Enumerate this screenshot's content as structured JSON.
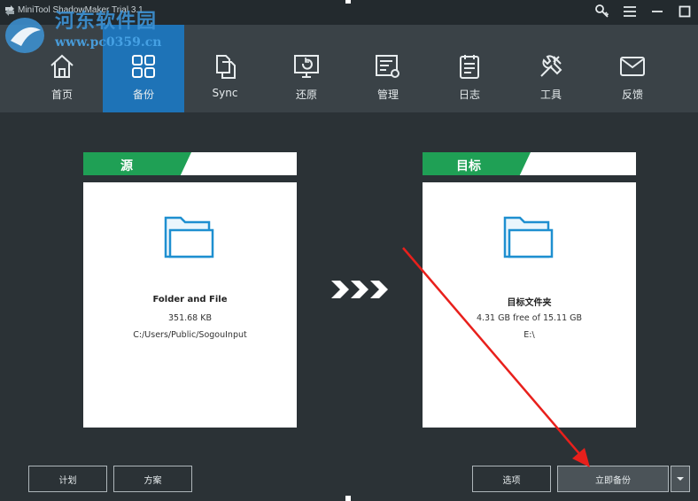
{
  "window": {
    "title": "MiniTool ShadowMaker Trial 3.1"
  },
  "watermark": {
    "brand": "河东软件园",
    "url": "www.pc0359.cn"
  },
  "nav": {
    "items": [
      {
        "label": "首页",
        "icon": "home-icon"
      },
      {
        "label": "备份",
        "icon": "backup-icon",
        "active": true
      },
      {
        "label": "Sync",
        "icon": "sync-icon"
      },
      {
        "label": "还原",
        "icon": "restore-icon"
      },
      {
        "label": "管理",
        "icon": "manage-icon"
      },
      {
        "label": "日志",
        "icon": "log-icon"
      },
      {
        "label": "工具",
        "icon": "tools-icon"
      },
      {
        "label": "反馈",
        "icon": "feedback-icon"
      }
    ]
  },
  "source": {
    "header": "源",
    "title": "Folder and File",
    "size": "351.68 KB",
    "path": "C:/Users/Public/SogouInput"
  },
  "destination": {
    "header": "目标",
    "title": "目标文件夹",
    "free": "4.31 GB free of 15.11 GB",
    "path": "E:\\"
  },
  "buttons": {
    "schedule": "计划",
    "scheme": "方案",
    "options": "选项",
    "backup_now": "立即备份"
  },
  "colors": {
    "accent": "#1e73b7",
    "header_green": "#1fa055",
    "annotation_red": "#e8201c"
  }
}
